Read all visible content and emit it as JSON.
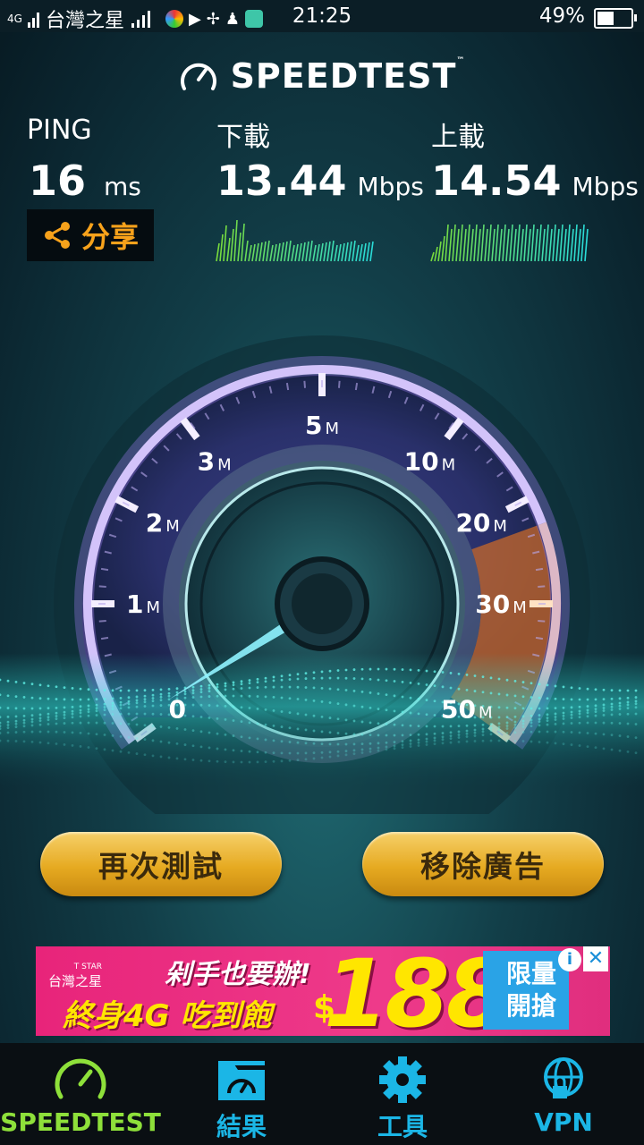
{
  "status_bar": {
    "network": "4G",
    "carrier": "台灣之星",
    "time": "21:25",
    "battery": "49%"
  },
  "app": {
    "title": "SPEEDTEST",
    "trademark": "™"
  },
  "metrics": {
    "ping": {
      "label": "PING",
      "value": "16",
      "unit": "ms"
    },
    "download": {
      "label": "下載",
      "value": "13.44",
      "unit": "Mbps"
    },
    "upload": {
      "label": "上載",
      "value": "14.54",
      "unit": "Mbps"
    }
  },
  "share_label": "分享",
  "gauge": {
    "ticks": [
      {
        "num": "0",
        "unit": ""
      },
      {
        "num": "1",
        "unit": "M"
      },
      {
        "num": "2",
        "unit": "M"
      },
      {
        "num": "3",
        "unit": "M"
      },
      {
        "num": "5",
        "unit": "M"
      },
      {
        "num": "10",
        "unit": "M"
      },
      {
        "num": "20",
        "unit": "M"
      },
      {
        "num": "30",
        "unit": "M"
      },
      {
        "num": "50",
        "unit": "M"
      }
    ],
    "needle_value_mbps": 0,
    "colors": {
      "accent": "#9a7bf0",
      "high": "#f08a2c",
      "needle": "#8ff3ff"
    }
  },
  "buttons": {
    "retest": "再次測試",
    "remove_ads": "移除廣告"
  },
  "ad": {
    "brand": "台灣之星",
    "brand_small": "T STAR",
    "slogan1": "剁手也要辦!",
    "slogan2": "終身4G 吃到飽",
    "currency": "$",
    "price": "188",
    "badge": "限量開搶",
    "info": "i",
    "close": "✕"
  },
  "nav": [
    {
      "label": "SPEEDTEST",
      "icon": "speedometer-icon",
      "active": true
    },
    {
      "label": "結果",
      "icon": "results-folder-icon",
      "active": false
    },
    {
      "label": "工具",
      "icon": "gear-icon",
      "active": false
    },
    {
      "label": "VPN",
      "icon": "vpn-globe-lock-icon",
      "active": false
    }
  ]
}
